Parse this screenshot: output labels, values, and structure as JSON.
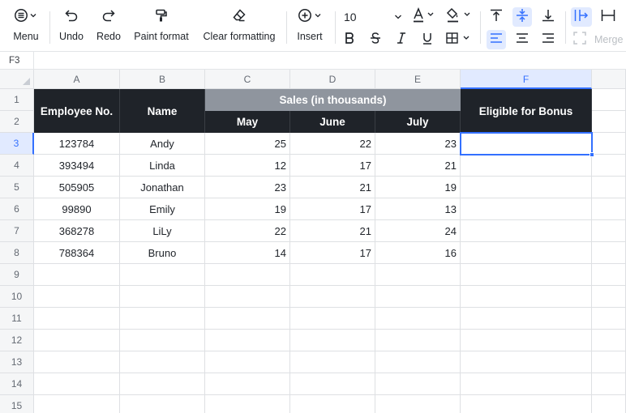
{
  "toolbar": {
    "menu_label": "Menu",
    "undo_label": "Undo",
    "redo_label": "Redo",
    "paint_format_label": "Paint format",
    "clear_formatting_label": "Clear formatting",
    "insert_label": "Insert",
    "font_size": "10",
    "merge_label": "Merge",
    "icons": [
      "menu-icon",
      "undo-icon",
      "redo-icon",
      "paint-format-icon",
      "eraser-icon",
      "plus-circle-icon",
      "text-color-icon",
      "fill-color-icon",
      "bold-icon",
      "strikethrough-icon",
      "italic-icon",
      "underline-icon",
      "borders-icon",
      "align-top-icon",
      "align-middle-icon",
      "align-bottom-icon",
      "align-left-icon",
      "align-center-icon",
      "align-right-icon",
      "freeze-icon",
      "merge-icon"
    ]
  },
  "namebox": {
    "value": "F3"
  },
  "columns": [
    "A",
    "B",
    "C",
    "D",
    "E",
    "F"
  ],
  "rows": [
    "1",
    "2",
    "3",
    "4",
    "5",
    "6",
    "7",
    "8",
    "9",
    "10",
    "11",
    "12",
    "13",
    "14",
    "15"
  ],
  "header": {
    "employee_no": "Employee No.",
    "name": "Name",
    "sales_group": "Sales (in thousands)",
    "may": "May",
    "june": "June",
    "july": "July",
    "bonus": "Eligible for Bonus"
  },
  "data_rows": [
    {
      "emp": "123784",
      "name": "Andy",
      "may": "25",
      "june": "22",
      "july": "23",
      "bonus": ""
    },
    {
      "emp": "393494",
      "name": "Linda",
      "may": "12",
      "june": "17",
      "july": "21",
      "bonus": ""
    },
    {
      "emp": "505905",
      "name": "Jonathan",
      "may": "23",
      "june": "21",
      "july": "19",
      "bonus": ""
    },
    {
      "emp": "99890",
      "name": "Emily",
      "may": "19",
      "june": "17",
      "july": "13",
      "bonus": ""
    },
    {
      "emp": "368278",
      "name": "LiLy",
      "may": "22",
      "june": "21",
      "july": "24",
      "bonus": ""
    },
    {
      "emp": "788364",
      "name": "Bruno",
      "may": "14",
      "june": "17",
      "july": "16",
      "bonus": ""
    }
  ],
  "colors": {
    "header_dark": "#1f2329",
    "header_gray": "#8f959e",
    "selection": "#3370ff",
    "selection_fill": "#e1eaff"
  }
}
